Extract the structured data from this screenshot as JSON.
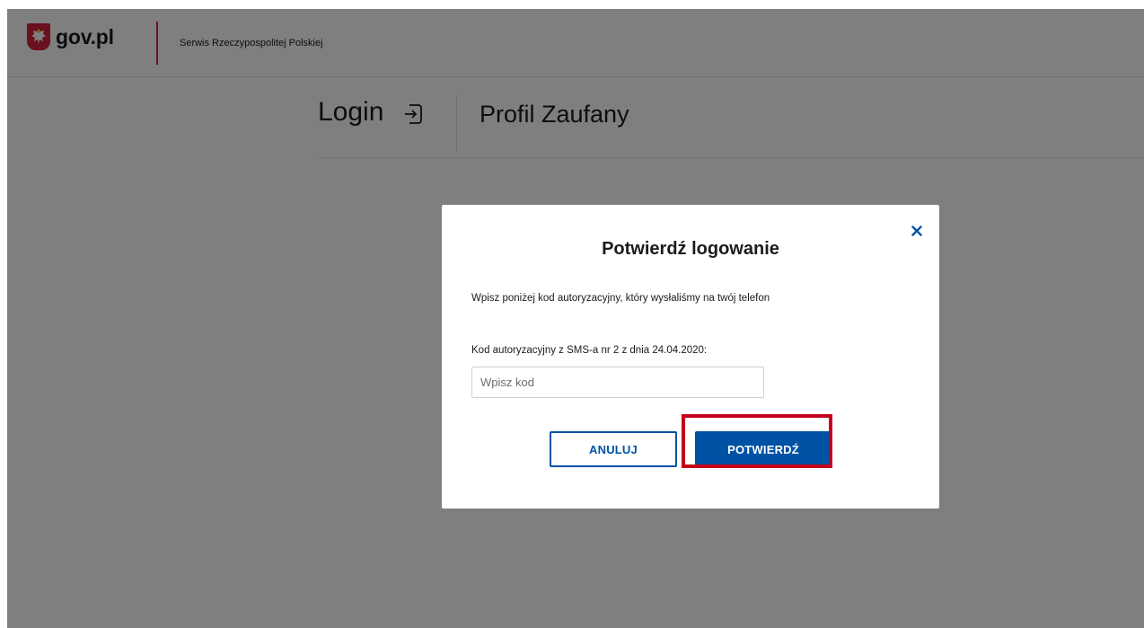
{
  "header": {
    "brand": "gov.pl",
    "service_name": "Serwis Rzeczypospolitej Polskiej"
  },
  "title_row": {
    "login_title": "Login",
    "login_icon": "login-arrow-icon",
    "profile_title": "Profil Zaufany"
  },
  "modal": {
    "title": "Potwierdź logowanie",
    "close_icon": "close-icon",
    "description": "Wpisz poniżej kod autoryzacyjny, który wysłaliśmy na twój telefon",
    "code_label": "Kod autoryzacyjny z SMS-a nr 2 z dnia 24.04.2020:",
    "code_placeholder": "Wpisz kod",
    "code_value": "",
    "cancel_label": "ANULUJ",
    "confirm_label": "POTWIERDŹ"
  },
  "colors": {
    "brand_red": "#d4213d",
    "primary_blue": "#0052a5",
    "highlight_red": "#c4001a",
    "overlay": "rgba(0,0,0,0.5)"
  }
}
